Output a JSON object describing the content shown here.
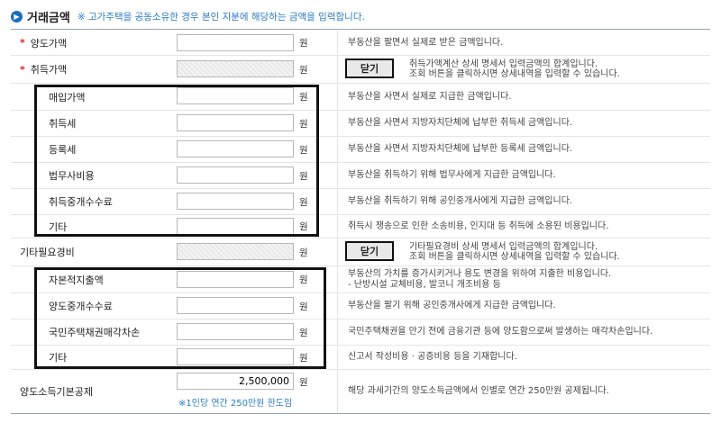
{
  "header": {
    "title": "거래금액",
    "note": "※ 고가주택을 공동소유한 경우 본인 지분에 해당하는 금액을 입력합니다."
  },
  "unit": "원",
  "close_label": "닫기",
  "rows": {
    "sale": {
      "label": "양도가액",
      "value": "",
      "desc": "부동산을 팔면서 실제로 받은 금액입니다."
    },
    "acq": {
      "label": "취득가액",
      "value": "",
      "desc1": "취득가액계산 상세 명세서 입력금액의 합계입니다.",
      "desc2": "조회 버튼을 클릭하시면 상세내역을 입력할 수 있습니다."
    },
    "purchase": {
      "label": "매입가액",
      "value": "",
      "desc": "부동산을 사면서 실제로 지급한 금액입니다."
    },
    "acqtax": {
      "label": "취득세",
      "value": "",
      "desc": "부동산을 사면서 지방자치단체에 납부한 취득세 금액입니다."
    },
    "regtax": {
      "label": "등록세",
      "value": "",
      "desc": "부동산을 사면서 지방자치단체에 납부한 등록세 금액입니다."
    },
    "legal": {
      "label": "법무사비용",
      "value": "",
      "desc": "부동산을 취득하기 위해 법무사에게 지급한 금액입니다."
    },
    "acqbroker": {
      "label": "취득중개수수료",
      "value": "",
      "desc": "부동산을 취득하기 위해 공인중개사에게 지급한 금액입니다."
    },
    "acqetc": {
      "label": "기타",
      "value": "",
      "desc": "취득시 쟁송으로 인한 소송비용, 인지대 등 취득에 소용된 비용입니다."
    },
    "otherexp": {
      "label": "기타필요경비",
      "value": "",
      "desc1": "기타필요경비 상세 명세서 입력금액의 합계입니다.",
      "desc2": "조회 버튼을 클릭하시면 상세내역을 입력할 수 있습니다."
    },
    "capital": {
      "label": "자본적지출액",
      "value": "",
      "desc1": "부동산의 가치를 증가시키거나 용도 변경을 위하여 지출한 비용입니다.",
      "desc2": "- 난방시설 교체비용, 발코니 개조비용 등"
    },
    "salebroker": {
      "label": "양도중개수수료",
      "value": "",
      "desc": "부동산을 팔기 위해 공인중개사에게 지급한 금액입니다."
    },
    "bondloss": {
      "label": "국민주택채권매각차손",
      "value": "",
      "desc": "국민주택채권을 만기 전에 금융기관 등에 양도함으로써 발생하는 매각차손입니다."
    },
    "saleetc": {
      "label": "기타",
      "value": "",
      "desc": "신고서 작성비용 · 공증비용 등을 기재합니다."
    },
    "basic": {
      "label": "양도소득기본공제",
      "value": "2,500,000",
      "limit": "※1인당 연간 250만원 한도임",
      "desc": "해당 과세기간의 양도소득금액에서 인별로 연간 250만원 공제됩니다."
    }
  }
}
